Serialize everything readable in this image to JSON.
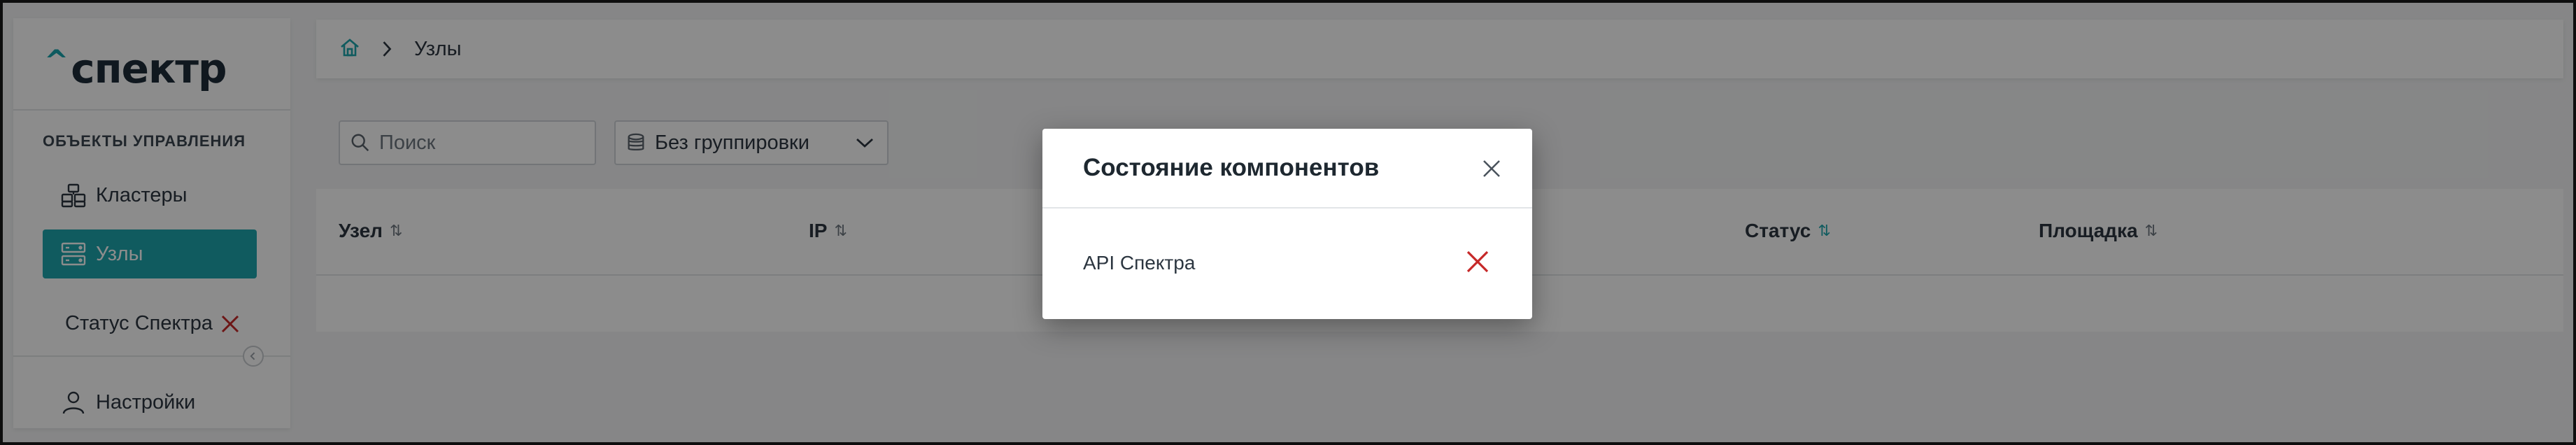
{
  "sidebar": {
    "logo": "спектр",
    "section_title": "ОБЪЕКТЫ УПРАВЛЕНИЯ",
    "items": [
      {
        "label": "Кластеры",
        "icon": "clusters-icon",
        "active": false
      },
      {
        "label": "Узлы",
        "icon": "nodes-icon",
        "active": true
      }
    ],
    "status_label": "Статус Спектра",
    "status_icon": "error-x-icon",
    "settings_label": "Настройки",
    "settings_icon": "user-icon"
  },
  "breadcrumb": {
    "home_icon": "home-icon",
    "items": [
      "Узлы"
    ]
  },
  "toolbar": {
    "search_placeholder": "Поиск",
    "grouping_label": "Без группировки"
  },
  "table": {
    "columns": [
      "Узел",
      "IP",
      "Статус",
      "Площадка"
    ]
  },
  "modal": {
    "title": "Состояние компонентов",
    "components": [
      {
        "name": "API Спектра",
        "status": "error"
      }
    ]
  },
  "colors": {
    "accent": "#1ea6ad",
    "error": "#c62828"
  }
}
